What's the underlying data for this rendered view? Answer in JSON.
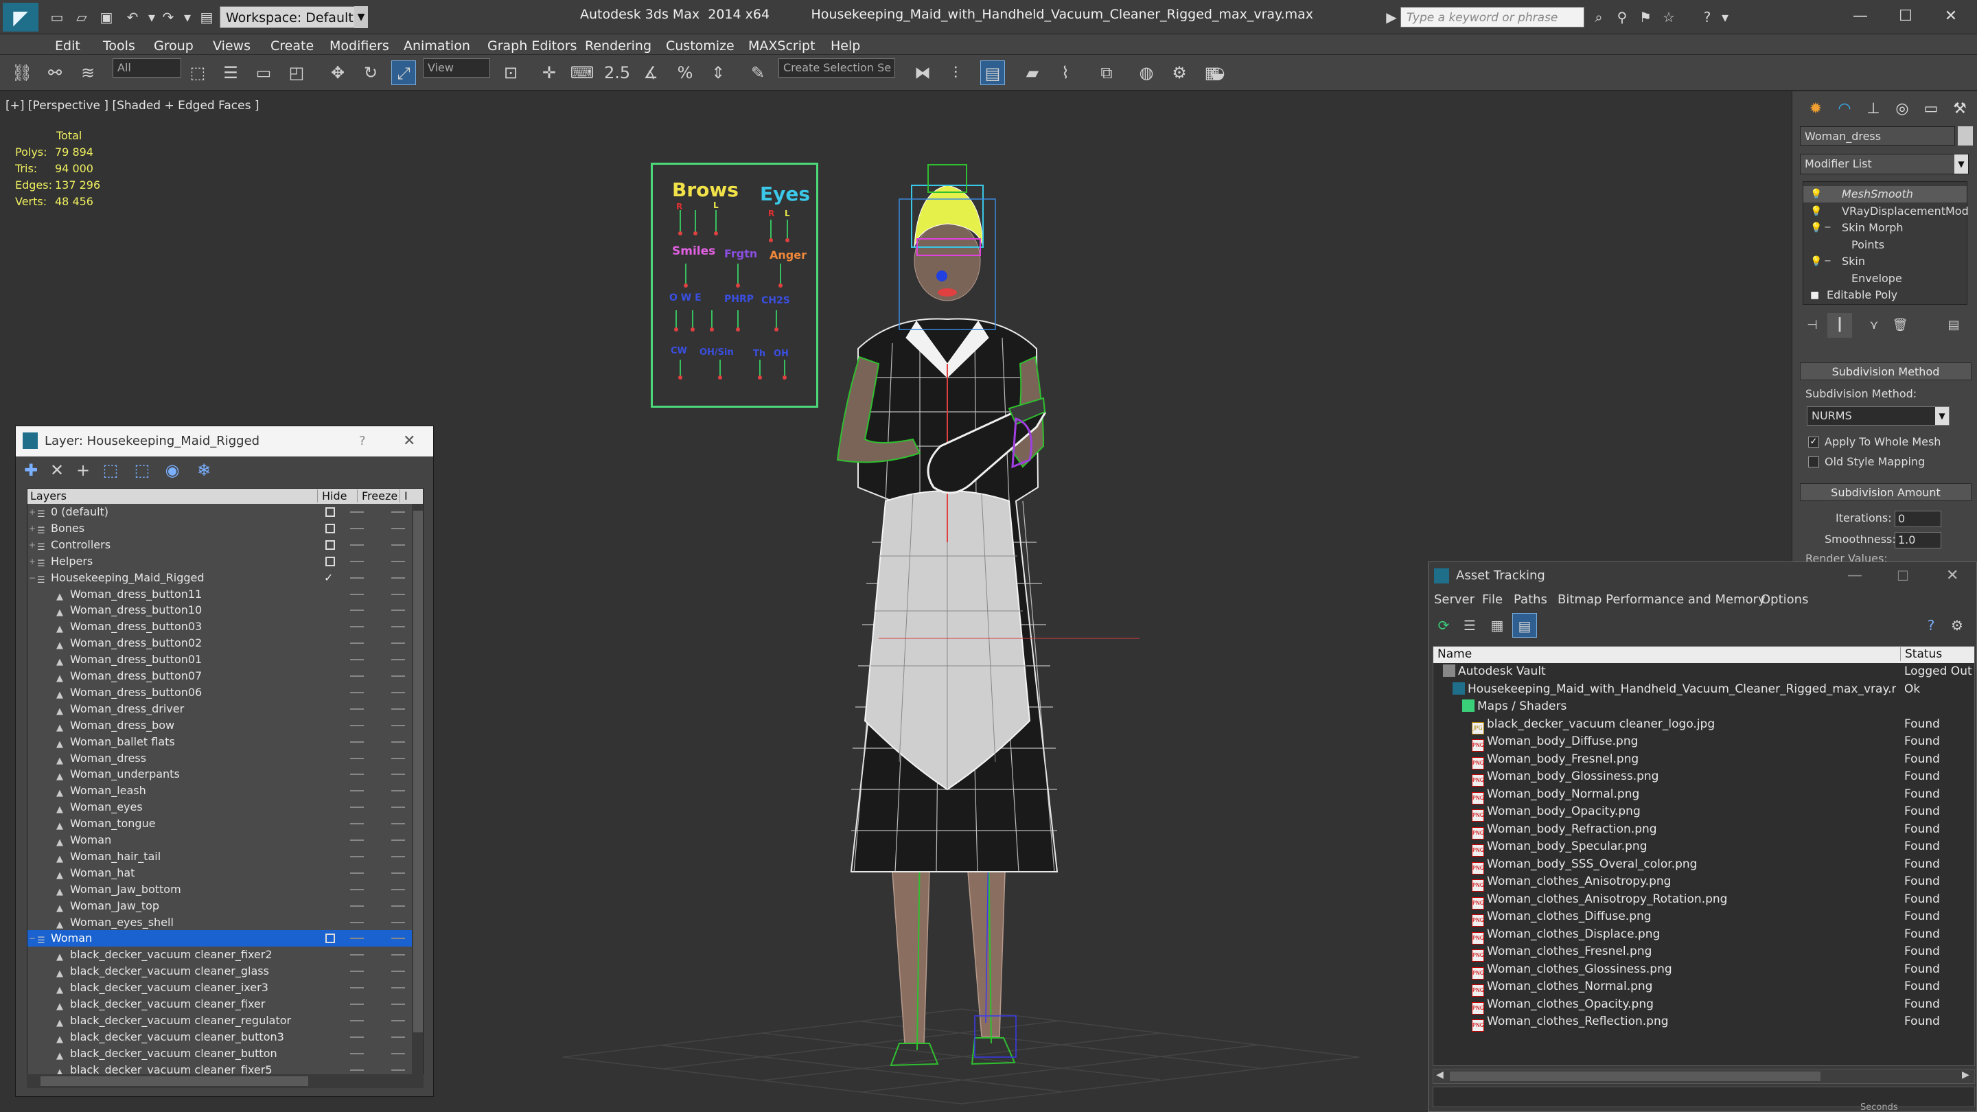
{
  "titlebar": {
    "workspace": "Workspace: Default",
    "app_name": "Autodesk 3ds Max  2014 x64",
    "file_name": "Housekeeping_Maid_with_Handheld_Vacuum_Cleaner_Rigged_max_vray.max",
    "search_placeholder": "Type a keyword or phrase",
    "minimize": "—",
    "maximize": "☐",
    "close": "✕"
  },
  "menubar": [
    "Edit",
    "Tools",
    "Group",
    "Views",
    "Create",
    "Modifiers",
    "Animation",
    "Graph Editors",
    "Rendering",
    "Customize",
    "MAXScript",
    "Help"
  ],
  "toolbar": {
    "filter_combo": "All",
    "refcoord_combo": "View",
    "snap_value": "2.5",
    "selection_set": "Create Selection Se"
  },
  "viewport": {
    "label": "[+] [Perspective ] [Shaded + Edged Faces ]",
    "stats": {
      "header": "Total",
      "rows": [
        {
          "k": "Polys:",
          "v": "79 894"
        },
        {
          "k": "Tris:",
          "v": "94 000"
        },
        {
          "k": "Edges:",
          "v": "137 296"
        },
        {
          "k": "Verts:",
          "v": "48 456"
        }
      ]
    },
    "board": {
      "brows": "Brows",
      "eyes": "Eyes",
      "smiles": "Smiles",
      "frown": "Frgtn",
      "anger": "Anger",
      "r1": "R",
      "l1": "L",
      "r2": "R",
      "l2": "L",
      "mouth1": "O  W  E",
      "mouth2": "PHRP",
      "mouth3": "CH2S",
      "tail1": "CW",
      "tail2": "OH/Sin",
      "tail3": "Th",
      "tail4": "OH"
    }
  },
  "layer_manager": {
    "title": "Layer: Housekeeping_Maid_Rigged",
    "help": "?",
    "close": "✕",
    "col_layers": "Layers",
    "col_hide": "Hide",
    "col_freeze": "Freeze",
    "col_extra": "I",
    "rows": [
      {
        "label": "0 (default)",
        "level": 0,
        "expand": "+",
        "check": "box"
      },
      {
        "label": "Bones",
        "level": 0,
        "expand": "+",
        "check": "box"
      },
      {
        "label": "Controllers",
        "level": 0,
        "expand": "+",
        "check": "box"
      },
      {
        "label": "Helpers",
        "level": 0,
        "expand": "+",
        "check": "box"
      },
      {
        "label": "Housekeeping_Maid_Rigged",
        "level": 0,
        "expand": "−",
        "check": "tick"
      },
      {
        "label": "Woman_dress_button11",
        "level": 1
      },
      {
        "label": "Woman_dress_button10",
        "level": 1
      },
      {
        "label": "Woman_dress_button03",
        "level": 1
      },
      {
        "label": "Woman_dress_button02",
        "level": 1
      },
      {
        "label": "Woman_dress_button01",
        "level": 1
      },
      {
        "label": "Woman_dress_button07",
        "level": 1
      },
      {
        "label": "Woman_dress_button06",
        "level": 1
      },
      {
        "label": "Woman_dress_driver",
        "level": 1
      },
      {
        "label": "Woman_dress_bow",
        "level": 1
      },
      {
        "label": "Woman_ballet flats",
        "level": 1
      },
      {
        "label": "Woman_dress",
        "level": 1
      },
      {
        "label": "Woman_underpants",
        "level": 1
      },
      {
        "label": "Woman_leash",
        "level": 1
      },
      {
        "label": "Woman_eyes",
        "level": 1
      },
      {
        "label": "Woman_tongue",
        "level": 1
      },
      {
        "label": "Woman",
        "level": 1
      },
      {
        "label": "Woman_hair_tail",
        "level": 1
      },
      {
        "label": "Woman_hat",
        "level": 1
      },
      {
        "label": "Woman_Jaw_bottom",
        "level": 1
      },
      {
        "label": "Woman_Jaw_top",
        "level": 1
      },
      {
        "label": "Woman_eyes_shell",
        "level": 1
      },
      {
        "label": "Woman",
        "level": 0,
        "expand": "−",
        "check": "box",
        "selected": true
      },
      {
        "label": "black_decker_vacuum cleaner_fixer2",
        "level": 1
      },
      {
        "label": "black_decker_vacuum cleaner_glass",
        "level": 1
      },
      {
        "label": "black_decker_vacuum cleaner_ixer3",
        "level": 1
      },
      {
        "label": "black_decker_vacuum cleaner_fixer",
        "level": 1
      },
      {
        "label": "black_decker_vacuum cleaner_regulator",
        "level": 1
      },
      {
        "label": "black_decker_vacuum cleaner_button3",
        "level": 1
      },
      {
        "label": "black_decker_vacuum cleaner_button",
        "level": 1
      },
      {
        "label": "black_decker_vacuum cleaner_fixer5",
        "level": 1
      }
    ]
  },
  "command_panel": {
    "object_name": "Woman_dress",
    "modifier_list": "Modifier List",
    "stack": [
      {
        "label": "MeshSmooth",
        "italic": true,
        "level": 0,
        "highlight": true
      },
      {
        "label": "VRayDisplacementMod",
        "level": 0
      },
      {
        "label": "Skin Morph",
        "level": 0,
        "box": "−"
      },
      {
        "label": "Points",
        "level": 1
      },
      {
        "label": "Skin",
        "level": 0,
        "box": "−"
      },
      {
        "label": "Envelope",
        "level": 1
      },
      {
        "label": "Editable Poly",
        "level": 0
      }
    ],
    "subdiv_method_title": "Subdivision Method",
    "subdiv_method_label": "Subdivision Method:",
    "subdiv_method_value": "NURMS",
    "apply_whole_mesh": "Apply To Whole Mesh",
    "old_style_mapping": "Old Style Mapping",
    "subdiv_amount_title": "Subdivision Amount",
    "iterations_label": "Iterations:",
    "iterations_value": "0",
    "smoothness_label": "Smoothness:",
    "smoothness_value": "1.0",
    "render_values_label": "Render Values:"
  },
  "asset_tracking": {
    "title": "Asset Tracking",
    "menu": [
      "Server",
      "File",
      "Paths",
      "Bitmap Performance and Memory",
      "Options"
    ],
    "col_name": "Name",
    "col_status": "Status",
    "rows": [
      {
        "label": "Autodesk Vault",
        "status": "Logged Out",
        "level": 0,
        "icon": "vault"
      },
      {
        "label": "Housekeeping_Maid_with_Handheld_Vacuum_Cleaner_Rigged_max_vray.max",
        "status": "Ok",
        "level": 1,
        "icon": "max"
      },
      {
        "label": "Maps / Shaders",
        "status": "",
        "level": 2,
        "icon": "folder"
      },
      {
        "label": "black_decker_vacuum cleaner_logo.jpg",
        "status": "Found",
        "level": 3,
        "icon": "jpg"
      },
      {
        "label": "Woman_body_Diffuse.png",
        "status": "Found",
        "level": 3,
        "icon": "png"
      },
      {
        "label": "Woman_body_Fresnel.png",
        "status": "Found",
        "level": 3,
        "icon": "png"
      },
      {
        "label": "Woman_body_Glossiness.png",
        "status": "Found",
        "level": 3,
        "icon": "png"
      },
      {
        "label": "Woman_body_Normal.png",
        "status": "Found",
        "level": 3,
        "icon": "png"
      },
      {
        "label": "Woman_body_Opacity.png",
        "status": "Found",
        "level": 3,
        "icon": "png"
      },
      {
        "label": "Woman_body_Refraction.png",
        "status": "Found",
        "level": 3,
        "icon": "png"
      },
      {
        "label": "Woman_body_Specular.png",
        "status": "Found",
        "level": 3,
        "icon": "png"
      },
      {
        "label": "Woman_body_SSS_Overal_color.png",
        "status": "Found",
        "level": 3,
        "icon": "png"
      },
      {
        "label": "Woman_clothes_Anisotropy.png",
        "status": "Found",
        "level": 3,
        "icon": "png"
      },
      {
        "label": "Woman_clothes_Anisotropy_Rotation.png",
        "status": "Found",
        "level": 3,
        "icon": "png"
      },
      {
        "label": "Woman_clothes_Diffuse.png",
        "status": "Found",
        "level": 3,
        "icon": "png"
      },
      {
        "label": "Woman_clothes_Displace.png",
        "status": "Found",
        "level": 3,
        "icon": "png"
      },
      {
        "label": "Woman_clothes_Fresnel.png",
        "status": "Found",
        "level": 3,
        "icon": "png"
      },
      {
        "label": "Woman_clothes_Glossiness.png",
        "status": "Found",
        "level": 3,
        "icon": "png"
      },
      {
        "label": "Woman_clothes_Normal.png",
        "status": "Found",
        "level": 3,
        "icon": "png"
      },
      {
        "label": "Woman_clothes_Opacity.png",
        "status": "Found",
        "level": 3,
        "icon": "png"
      },
      {
        "label": "Woman_clothes_Reflection.png",
        "status": "Found",
        "level": 3,
        "icon": "png"
      }
    ],
    "png_icon_text": "PNG",
    "jpg_icon_text": "JPG",
    "seconds_label": "Seconds"
  },
  "colors": {
    "selection": "#1a62d0",
    "stats_text": "#f0f060",
    "board_border": "#4cd97a"
  }
}
